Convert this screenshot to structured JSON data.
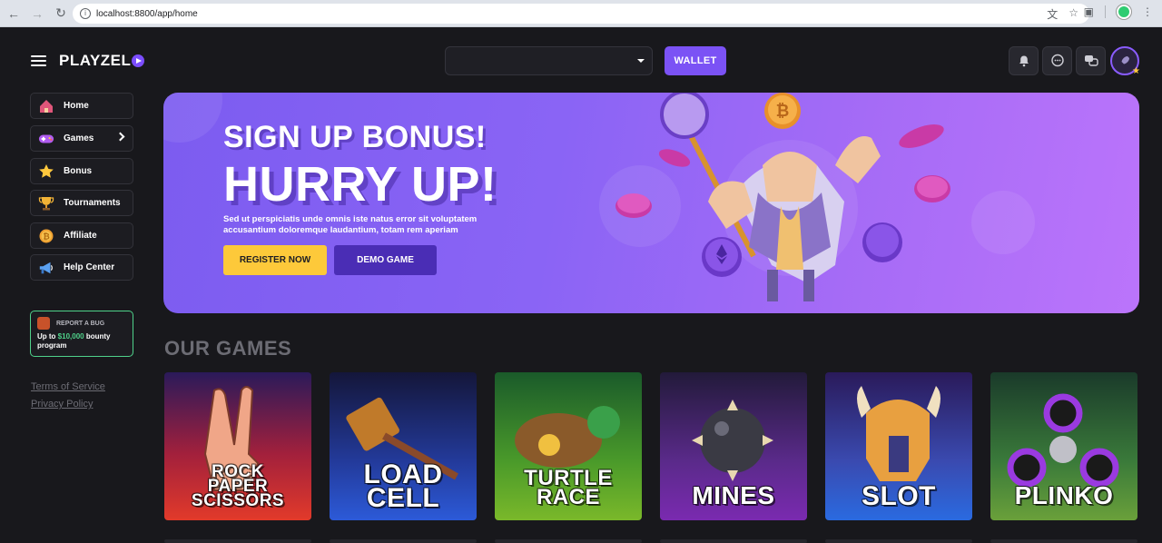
{
  "browser": {
    "url": "localhost:8800/app/home"
  },
  "header": {
    "logo": "PLAYZEL",
    "wallet_label": "WALLET"
  },
  "sidebar": {
    "items": [
      {
        "label": "Home",
        "icon": "house-icon"
      },
      {
        "label": "Games",
        "icon": "gamepad-icon"
      },
      {
        "label": "Bonus",
        "icon": "star-icon"
      },
      {
        "label": "Tournaments",
        "icon": "trophy-icon"
      },
      {
        "label": "Affiliate",
        "icon": "coin-icon"
      },
      {
        "label": "Help Center",
        "icon": "megaphone-icon"
      }
    ],
    "bug_card": {
      "heading": "REPORT A BUG",
      "text_prefix": "Up to ",
      "amount": "$10,000",
      "text_suffix": " bounty program"
    },
    "footer_links": [
      "Terms of Service",
      "Privacy Policy"
    ]
  },
  "banner": {
    "title_line1": "SIGN UP BONUS!",
    "title_line2": "HURRY UP!",
    "description": "Sed ut perspiciatis unde omnis iste natus error sit voluptatem accusantium doloremque laudantium, totam rem aperiam",
    "register_label": "REGISTER NOW",
    "demo_label": "DEMO GAME"
  },
  "games_section": {
    "title": "OUR GAMES",
    "games": [
      {
        "title": "ROCK PAPER SCISSORS",
        "lines": [
          "ROCK",
          "PAPER",
          "SCISSORS"
        ]
      },
      {
        "title": "LOAD CELL",
        "lines": [
          "LOAD",
          "CELL"
        ]
      },
      {
        "title": "TURTLE RACE",
        "lines": [
          "TURTLE",
          "RACE"
        ]
      },
      {
        "title": "MINES",
        "lines": [
          "MINES"
        ]
      },
      {
        "title": "SLOT",
        "lines": [
          "SLOT"
        ]
      },
      {
        "title": "PLINKO",
        "lines": [
          "PLINKO"
        ]
      }
    ]
  },
  "colors": {
    "accent": "#7b52f5",
    "register": "#fdc93a",
    "bounty_green": "#4fd28a"
  }
}
